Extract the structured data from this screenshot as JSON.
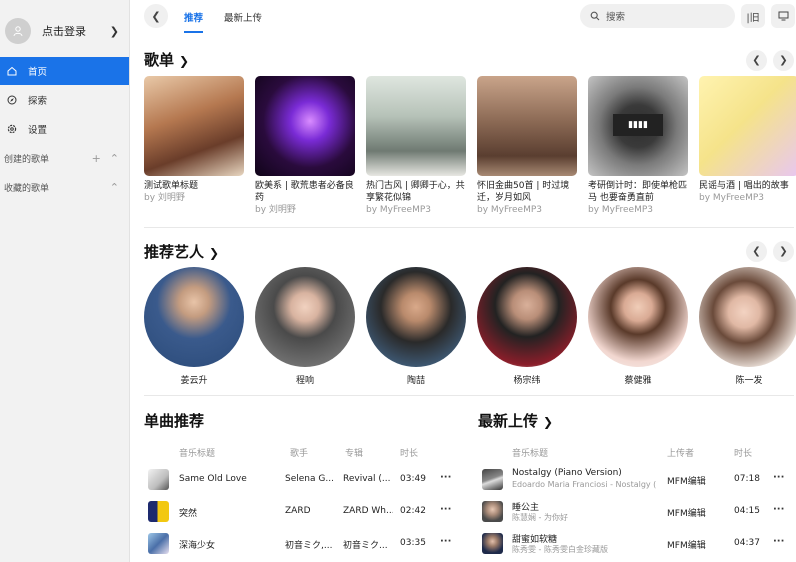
{
  "sidebar": {
    "login_label": "点击登录",
    "nav": [
      {
        "label": "首页"
      },
      {
        "label": "探索"
      },
      {
        "label": "设置"
      }
    ],
    "created_playlists": "创建的歌单",
    "collected_playlists": "收藏的歌单"
  },
  "topbar": {
    "tabs": [
      "推荐",
      "最新上传"
    ],
    "search_placeholder": "搜索"
  },
  "playlists_section": {
    "title": "歌单",
    "items": [
      {
        "title": "测试歌单标题",
        "by": "by 刘明野"
      },
      {
        "title": "欧美系 | 歌荒患者必备良药",
        "by": "by 刘明野"
      },
      {
        "title": "热门古风 | 卿卿于心，共享繁花似锦",
        "by": "by MyFreeMP3"
      },
      {
        "title": "怀旧金曲50首 | 时过境迁，岁月如风",
        "by": "by MyFreeMP3"
      },
      {
        "title": "考研倒计时：即使单枪匹马 也要奋勇直前",
        "by": "by MyFreeMP3"
      },
      {
        "title": "民谣与酒 | 唱出的故事",
        "by": "by MyFreeMP3"
      }
    ]
  },
  "artists_section": {
    "title": "推荐艺人",
    "items": [
      {
        "name": "姜云升"
      },
      {
        "name": "程响"
      },
      {
        "name": "陶喆"
      },
      {
        "name": "杨宗纬"
      },
      {
        "name": "蔡健雅"
      },
      {
        "name": "陈一发"
      }
    ]
  },
  "singles_section": {
    "title": "单曲推荐",
    "headers": [
      "音乐标题",
      "歌手",
      "专辑",
      "时长"
    ],
    "rows": [
      {
        "title": "Same Old Love",
        "artist": "Selena G...",
        "album": "Revival (...",
        "duration": "03:49"
      },
      {
        "title": "突然",
        "artist": "ZARD",
        "album": "ZARD Wh...",
        "duration": "02:42"
      },
      {
        "title": "深海少女",
        "artist": "初音ミク,...",
        "album": "初音ミク...",
        "duration": "03:35"
      }
    ]
  },
  "latest_section": {
    "title": "最新上传",
    "headers": [
      "音乐标题",
      "上传者",
      "时长"
    ],
    "rows": [
      {
        "title": "Nostalgy (Piano Version)",
        "sub": "Edoardo Maria Franciosi - Nostalgy (...",
        "uploader": "MFM编辑",
        "duration": "07:18"
      },
      {
        "title": "睡公主",
        "sub": "陈慧娴 - 为你好",
        "uploader": "MFM编辑",
        "duration": "04:15"
      },
      {
        "title": "甜蜜如软糖",
        "sub": "陈秀雯 - 陈秀雯白金珍藏版",
        "uploader": "MFM编辑",
        "duration": "04:37"
      }
    ]
  },
  "more_glyph": "···",
  "colors": {
    "accent": "#1a73e8",
    "sidebar_bg": "#f2f2f2"
  }
}
